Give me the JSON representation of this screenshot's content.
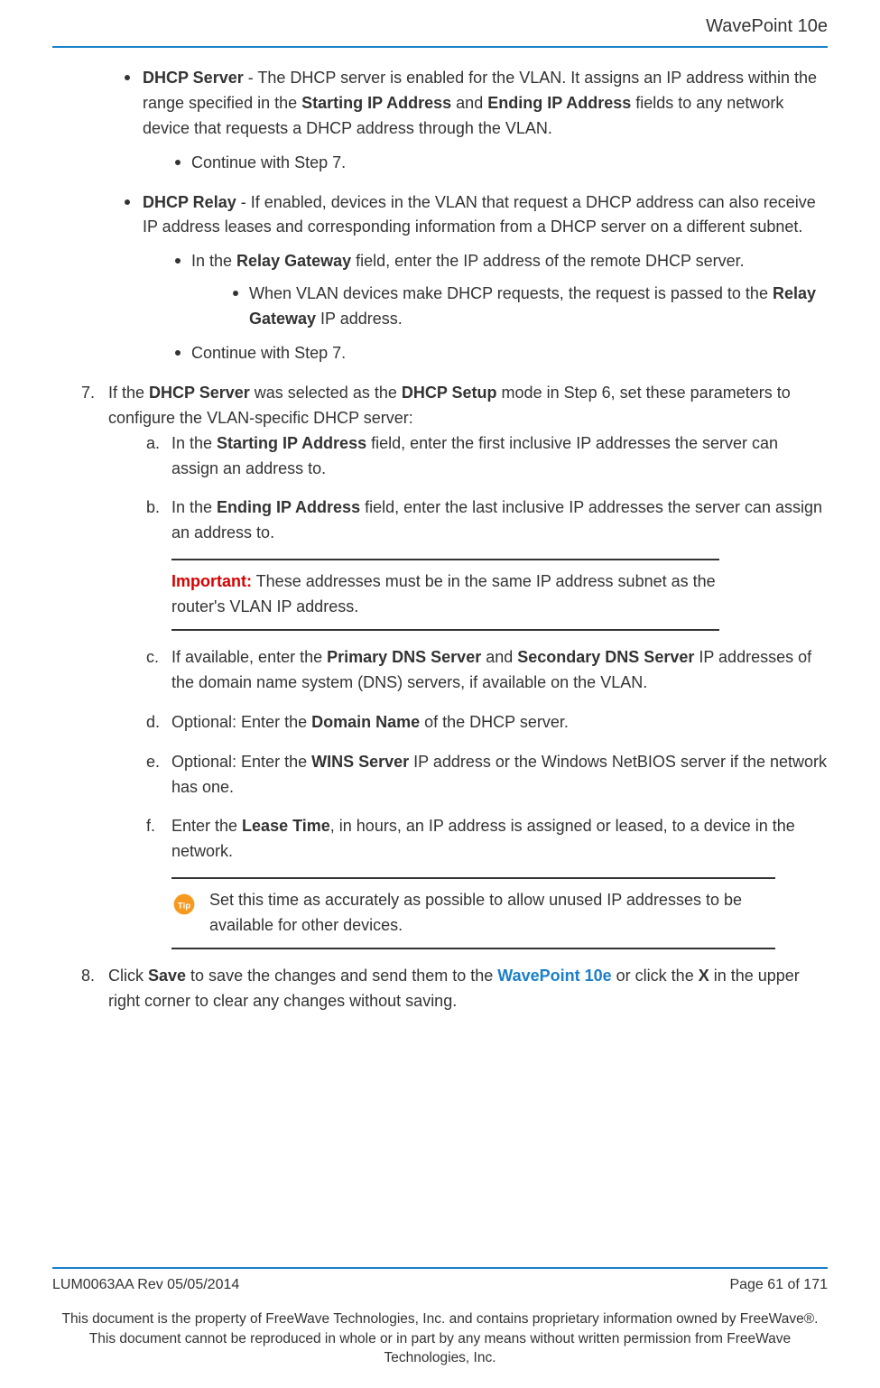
{
  "header": {
    "product": "WavePoint 10e"
  },
  "bullets": {
    "dhcp_server_label": "DHCP Server",
    "dhcp_server_text_1": " - The DHCP server is enabled for the VLAN. It assigns an IP address within the range specified in the ",
    "starting_ip_bold": "Starting IP Address",
    "and_txt": " and ",
    "ending_ip_bold": "Ending IP Address",
    "dhcp_server_text_2": " fields to any network device that requests a DHCP address through the VLAN.",
    "continue_step7": "Continue with Step 7.",
    "dhcp_relay_label": "DHCP Relay",
    "dhcp_relay_text": " - If enabled, devices in the VLAN that request a DHCP address can also receive IP address leases and corresponding information from a DHCP server on a different subnet.",
    "relay_gw_pre": "In the ",
    "relay_gw_bold": "Relay Gateway",
    "relay_gw_post": " field, enter the IP address of the remote DHCP server.",
    "relay_sub_pre": "When VLAN devices make DHCP requests, the request is passed to the ",
    "relay_sub_bold": "Relay Gateway",
    "relay_sub_post": " IP address."
  },
  "step7": {
    "pre": "If the ",
    "b1": "DHCP Server",
    "mid": " was selected as the ",
    "b2": "DHCP Setup",
    "post": " mode in Step 6, set these parameters to configure the VLAN-specific DHCP server:",
    "a_pre": "In the ",
    "a_bold": "Starting IP Address",
    "a_post": " field, enter the first inclusive IP addresses the server can assign an address to.",
    "b_pre": "In the ",
    "b_bold": "Ending IP Address",
    "b_post": " field, enter the last inclusive IP addresses the server can assign an address to.",
    "important_label": "Important:",
    "important_text": " These addresses must be in the same IP address subnet as the router's VLAN IP address.",
    "c_pre": "If available, enter the ",
    "c_b1": "Primary DNS Server",
    "c_and": " and ",
    "c_b2": "Secondary DNS Server",
    "c_post": " IP addresses of the domain name system (DNS) servers, if available on the VLAN.",
    "d_pre": "Optional: Enter the ",
    "d_bold": "Domain Name",
    "d_post": " of the DHCP server.",
    "e_pre": "Optional: Enter the ",
    "e_bold": "WINS Server",
    "e_post": " IP address or the Windows NetBIOS server if the network has one.",
    "f_pre": "Enter the ",
    "f_bold": "Lease Time",
    "f_post": ", in hours, an IP address is assigned or leased, to a device in the network.",
    "tip_text": "Set this time as accurately as possible to allow unused IP addresses to be available for other devices."
  },
  "step8": {
    "pre": "Click ",
    "save": "Save",
    "mid1": " to save the changes and send them to the ",
    "link": "WavePoint 10e",
    "mid2": " or click the ",
    "x": "X",
    "post": " in the upper right corner to clear any changes without saving."
  },
  "footer": {
    "rev": "LUM0063AA Rev 05/05/2014",
    "page": "Page 61 of 171",
    "note": "This document is the property of FreeWave Technologies, Inc. and contains proprietary information owned by FreeWave®. This document cannot be reproduced in whole or in part by any means without written permission from FreeWave Technologies, Inc."
  },
  "labels": {
    "n7": "7.",
    "n8": "8.",
    "la": "a.",
    "lb": "b.",
    "lc": "c.",
    "ld": "d.",
    "le": "e.",
    "lf": "f."
  }
}
